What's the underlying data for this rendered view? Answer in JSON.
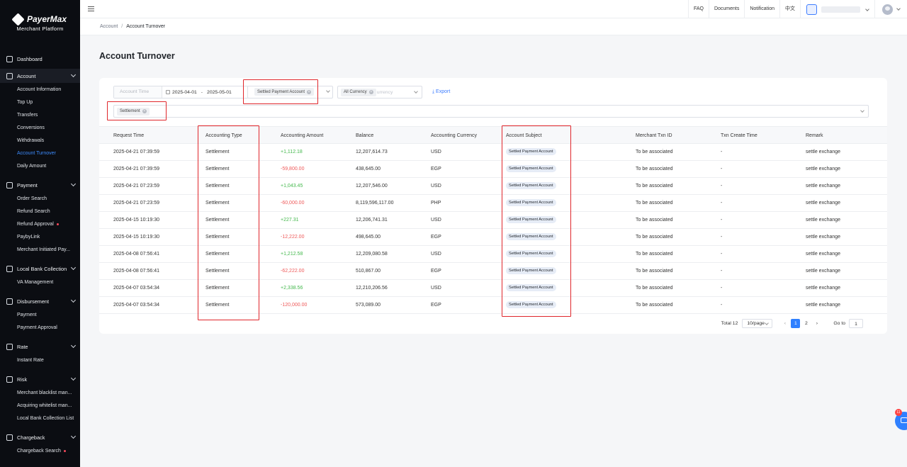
{
  "brand": {
    "name": "PayerMax",
    "subtitle": "Merchant  Platform"
  },
  "sidebar": {
    "dashboard": "Dashboard",
    "account": {
      "label": "Account",
      "items": [
        "Account Information",
        "Top Up",
        "Transfers",
        "Conversions",
        "Withdrawals",
        "Account Turnover",
        "Daily Amount"
      ]
    },
    "payment": {
      "label": "Payment",
      "items": [
        "Order Search",
        "Refund Search",
        "Refund Approval",
        "PaybyLink",
        "Merchant Initiated Pay..."
      ]
    },
    "local_bank": {
      "label": "Local Bank Collection",
      "items": [
        "VA Management"
      ]
    },
    "disbursement": {
      "label": "Disbursement",
      "items": [
        "Payment",
        "Payment Approval"
      ]
    },
    "rate": {
      "label": "Rate",
      "items": [
        "Instant Rate"
      ]
    },
    "risk": {
      "label": "Risk",
      "items": [
        "Merchant blacklist man...",
        "Acquiring whitelist man...",
        "Local Bank Collection List"
      ]
    },
    "chargeback": {
      "label": "Chargeback",
      "items": [
        "Chargeback Search"
      ]
    }
  },
  "topbar": {
    "faq": "FAQ",
    "documents": "Documents",
    "notification": "Notification",
    "lang": "中文"
  },
  "breadcrumb": {
    "parent": "Account",
    "current": "Account Turnover"
  },
  "page": {
    "title": "Account Turnover"
  },
  "filters": {
    "time_label": "Account Time",
    "date_from": "2025-04-01",
    "date_to": "2025-05-01",
    "subject_tag": "Settled Payment Account",
    "currency_tag": "All Currency",
    "currency_placeholder": "urrency",
    "export": "Export",
    "type_tag": "Settlement"
  },
  "table": {
    "headers": [
      "Request Time",
      "Accounting Type",
      "Accounting Amount",
      "Balance",
      "Accounting Currency",
      "Account Subject",
      "Merchant Txn ID",
      "Txn Create Time",
      "Remark"
    ],
    "rows": [
      {
        "time": "2025-04-21 07:39:59",
        "type": "Settlement",
        "amount": "+1,112.18",
        "balance": "12,207,614.73",
        "currency": "USD",
        "subject": "Settled Payment Account",
        "txn": "To be associated",
        "create": "-",
        "remark": "settle exchange"
      },
      {
        "time": "2025-04-21 07:39:59",
        "type": "Settlement",
        "amount": "-59,800.00",
        "balance": "438,645.00",
        "currency": "EGP",
        "subject": "Settled Payment Account",
        "txn": "To be associated",
        "create": "-",
        "remark": "settle exchange"
      },
      {
        "time": "2025-04-21 07:23:59",
        "type": "Settlement",
        "amount": "+1,043.45",
        "balance": "12,207,546.00",
        "currency": "USD",
        "subject": "Settled Payment Account",
        "txn": "To be associated",
        "create": "-",
        "remark": "settle exchange"
      },
      {
        "time": "2025-04-21 07:23:59",
        "type": "Settlement",
        "amount": "-60,000.00",
        "balance": "8,119,596,117.00",
        "currency": "PHP",
        "subject": "Settled Payment Account",
        "txn": "To be associated",
        "create": "-",
        "remark": "settle exchange"
      },
      {
        "time": "2025-04-15 10:19:30",
        "type": "Settlement",
        "amount": "+227.31",
        "balance": "12,206,741.31",
        "currency": "USD",
        "subject": "Settled Payment Account",
        "txn": "To be associated",
        "create": "-",
        "remark": "settle exchange"
      },
      {
        "time": "2025-04-15 10:19:30",
        "type": "Settlement",
        "amount": "-12,222.00",
        "balance": "498,645.00",
        "currency": "EGP",
        "subject": "Settled Payment Account",
        "txn": "To be associated",
        "create": "-",
        "remark": "settle exchange"
      },
      {
        "time": "2025-04-08 07:56:41",
        "type": "Settlement",
        "amount": "+1,212.58",
        "balance": "12,209,080.58",
        "currency": "USD",
        "subject": "Settled Payment Account",
        "txn": "To be associated",
        "create": "-",
        "remark": "settle exchange"
      },
      {
        "time": "2025-04-08 07:56:41",
        "type": "Settlement",
        "amount": "-62,222.00",
        "balance": "510,867.00",
        "currency": "EGP",
        "subject": "Settled Payment Account",
        "txn": "To be associated",
        "create": "-",
        "remark": "settle exchange"
      },
      {
        "time": "2025-04-07 03:54:34",
        "type": "Settlement",
        "amount": "+2,338.56",
        "balance": "12,210,206.56",
        "currency": "USD",
        "subject": "Settled Payment Account",
        "txn": "To be associated",
        "create": "-",
        "remark": "settle exchange"
      },
      {
        "time": "2025-04-07 03:54:34",
        "type": "Settlement",
        "amount": "-120,000.00",
        "balance": "573,089.00",
        "currency": "EGP",
        "subject": "Settled Payment Account",
        "txn": "To be associated",
        "create": "-",
        "remark": "settle exchange"
      }
    ]
  },
  "pagination": {
    "total": "Total 12",
    "page_size": "10/page",
    "pages": [
      "1",
      "2"
    ],
    "goto_label": "Go to",
    "goto_value": "1"
  },
  "chat": {
    "badge": "11"
  },
  "colors": {
    "accent": "#2f80ff",
    "positive": "#43b84c",
    "negative": "#ef5a5a",
    "highlight": "#e0262b",
    "sidebar_bg": "#0b0d12"
  }
}
